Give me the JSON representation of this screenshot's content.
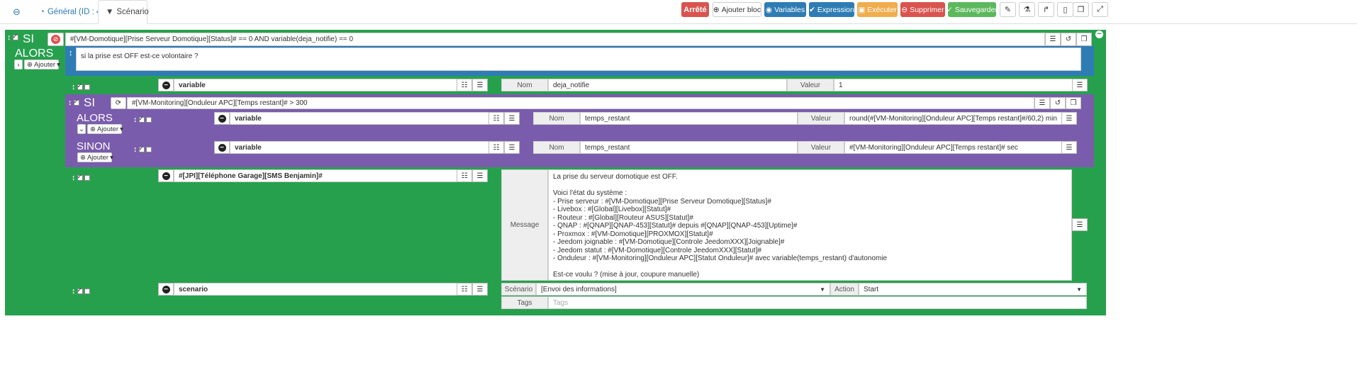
{
  "tabs": {
    "back_icon": "arrow-circle-left-icon",
    "general": "Général (ID : 4)",
    "scenario": "Scénario"
  },
  "toolbar": {
    "status": "Arrêté",
    "add_block": "Ajouter bloc",
    "variables": "Variables",
    "expression": "Expression",
    "execute": "Exécuter",
    "delete": "Supprimer",
    "save": "Sauvegarder",
    "colors": {
      "status": "#d9534f",
      "variables": "#2e7cb4",
      "expression": "#2e7cb4",
      "execute": "#f0ad4e",
      "delete": "#d9534f",
      "save": "#5cb85c"
    }
  },
  "block1": {
    "si_label": "SI",
    "alors_label": "ALORS",
    "add_label": "Ajouter",
    "condition": "#[VM-Domotique][Prise Serveur Domotique][Status]# == 0 AND variable(deja_notifie) == 0",
    "comment": "si la prise est OFF est-ce volontaire ?"
  },
  "action_variable1": {
    "type": "variable",
    "name_label": "Nom",
    "name_value": "deja_notifie",
    "value_label": "Valeur",
    "value_value": "1"
  },
  "block2": {
    "si_label": "SI",
    "alors_label": "ALORS",
    "sinon_label": "SINON",
    "add_label": "Ajouter",
    "condition": "#[VM-Monitoring][Onduleur APC][Temps restant]# > 300",
    "alors_action": {
      "type": "variable",
      "name_label": "Nom",
      "name_value": "temps_restant",
      "value_label": "Valeur",
      "value_value": "round(#[VM-Monitoring][Onduleur APC][Temps restant]#/60,2) min"
    },
    "sinon_action": {
      "type": "variable",
      "name_label": "Nom",
      "name_value": "temps_restant",
      "value_label": "Valeur",
      "value_value": "#[VM-Monitoring][Onduleur APC][Temps restant]# sec"
    }
  },
  "action_sms": {
    "command": "#[JPI][Téléphone Garage][SMS Benjamin]#",
    "message_label": "Message",
    "message_lines": [
      "La prise du serveur domotique est OFF.",
      "",
      "Voici l'état du système :",
      "- Prise serveur : #[VM-Domotique][Prise Serveur Domotique][Status]#",
      "- Livebox : #[Global][Livebox][Statut]#",
      "- Routeur : #[Global][Routeur ASUS][Statut]#",
      "- QNAP : #[QNAP][QNAP-453][Statut]# depuis #[QNAP][QNAP-453][Uptime]#",
      "- Proxmox : #[VM-Domotique][PROXMOX][Statut]#",
      "- Jeedom joignable : #[VM-Domotique][Controle JeedomXXX][Joignable]#",
      "- Jeedom statut : #[VM-Domotique][Controle JeedomXXX][Statut]#",
      "- Onduleur : #[VM-Monitoring][Onduleur APC][Statut Onduleur]# avec variable(temps_restant) d'autonomie",
      "",
      "Est-ce voulu ? (mise à jour, coupure manuelle)"
    ]
  },
  "action_scenario": {
    "type": "scenario",
    "scenario_label": "Scénario",
    "scenario_value": "[Envoi des informations]",
    "action_label": "Action",
    "action_value": "Start",
    "tags_label": "Tags",
    "tags_placeholder": "Tags"
  }
}
